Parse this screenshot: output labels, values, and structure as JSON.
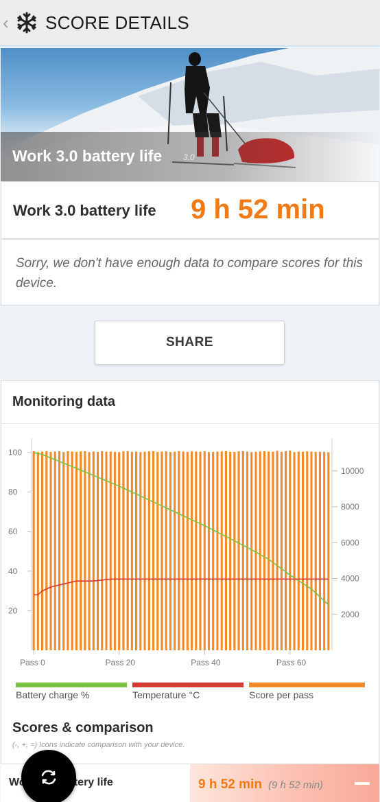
{
  "header": {
    "title": "SCORE DETAILS",
    "back_icon": "chevron-left-icon",
    "app_icon": "snowflake-icon"
  },
  "hero": {
    "title": "Work 3.0 battery life",
    "version": "3.0"
  },
  "score": {
    "label": "Work 3.0 battery life",
    "value": "9 h 52 min"
  },
  "note": {
    "text": "Sorry, we don't have enough data to compare scores for this device."
  },
  "share": {
    "label": "SHARE"
  },
  "monitoring": {
    "title": "Monitoring data",
    "legend": [
      {
        "label": "Battery charge %",
        "color": "#7cc242"
      },
      {
        "label": "Temperature °C",
        "color": "#d63a35"
      },
      {
        "label": "Score per pass",
        "color": "#f08a2a"
      }
    ]
  },
  "chart_data": {
    "type": "bar",
    "x_tick_labels": [
      "Pass 0",
      "Pass 20",
      "Pass 40",
      "Pass 60"
    ],
    "x_ticks": [
      0,
      20,
      40,
      60
    ],
    "left_axis": {
      "ticks": [
        20,
        40,
        60,
        80,
        100
      ],
      "ylim": [
        0,
        100
      ]
    },
    "right_axis": {
      "ticks": [
        2000,
        4000,
        6000,
        8000,
        10000
      ],
      "ylim": [
        0,
        11600
      ]
    },
    "grid": false,
    "legend_position": "bottom",
    "series": [
      {
        "name": "Score per pass",
        "type": "bar",
        "axis": "right",
        "values": [
          11100,
          11050,
          11080,
          11100,
          11060,
          11080,
          11100,
          11050,
          11100,
          11080,
          11060,
          11090,
          11100,
          11050,
          11080,
          11060,
          11100,
          11070,
          11080,
          11060,
          11050,
          11090,
          11100,
          11060,
          11080,
          11050,
          11070,
          11090,
          11100,
          11060,
          11080,
          11090,
          11050,
          11070,
          11100,
          11080,
          11060,
          11090,
          11080,
          11070,
          11100,
          11050,
          11060,
          11080,
          11090,
          11100,
          11070,
          11060,
          11090,
          11100,
          11080,
          11050,
          11060,
          11090,
          11100,
          11080,
          11070,
          11120,
          11060,
          11100,
          11130,
          11050,
          11080,
          11070,
          11090,
          11080,
          11060,
          11070,
          11060,
          11040
        ]
      },
      {
        "name": "Battery charge %",
        "type": "line",
        "axis": "left",
        "x": [
          0,
          2,
          10,
          20,
          30,
          40,
          50,
          55,
          60,
          65,
          69
        ],
        "values": [
          100,
          99,
          92,
          83,
          73,
          63,
          52,
          46,
          38,
          31,
          23
        ]
      },
      {
        "name": "Temperature °C",
        "type": "line",
        "axis": "left",
        "x": [
          0,
          1,
          2,
          4,
          6,
          8,
          10,
          14,
          18,
          30,
          40,
          50,
          60,
          69
        ],
        "values": [
          28,
          28,
          30,
          32,
          33,
          34,
          35,
          35,
          36,
          36,
          36,
          36,
          36,
          36
        ]
      }
    ]
  },
  "scores": {
    "title": "Scores & comparison",
    "subtitle": "(-, +, =) Icons indicate comparison with your device."
  },
  "bottom_row": {
    "label": "Work 3.0 battery life",
    "value": "9 h 52 min",
    "compare": "(9 h 52 min)"
  },
  "fab": {
    "icon": "refresh-icon"
  }
}
